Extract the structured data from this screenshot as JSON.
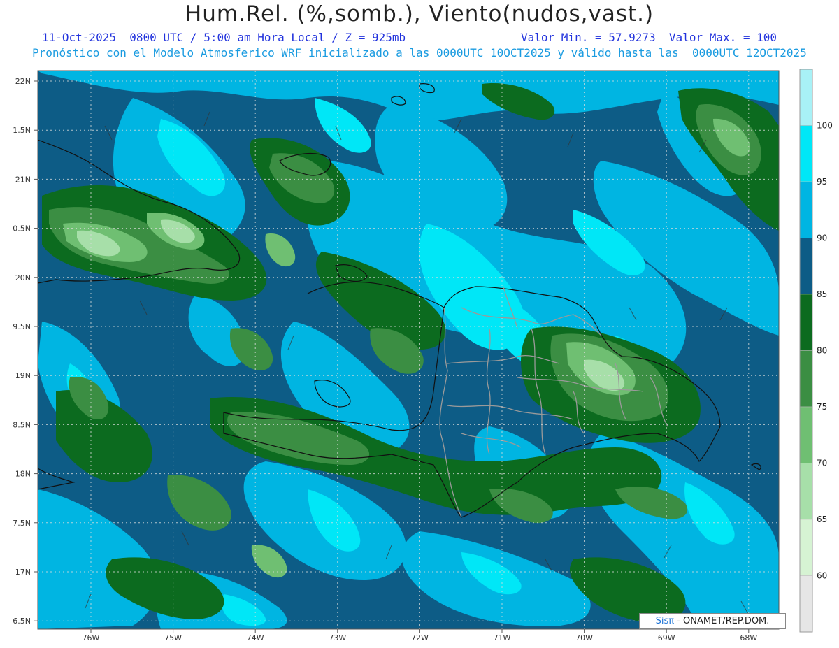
{
  "header": {
    "title": "Hum.Rel. (%,somb.), Viento(nudos,vast.)",
    "valid_time": "11-Oct-2025  0800 UTC / 5:00 am Hora Local / Z = 925mb",
    "min_max": "Valor Min. = 57.9273  Valor Max. = 100",
    "model_info": "Pronóstico con el Modelo Atmosferico WRF inicializado a las 0000UTC_10OCT2025 y válido hasta las  0000UTC_12OCT2025"
  },
  "map": {
    "lat_labels": [
      "22N",
      "1.5N",
      "21N",
      "0.5N",
      "20N",
      "9.5N",
      "19N",
      "8.5N",
      "18N",
      "7.5N",
      "17N",
      "6.5N"
    ],
    "lon_labels": [
      "76W",
      "75W",
      "74W",
      "73W",
      "72W",
      "71W",
      "70W",
      "69W",
      "68W"
    ],
    "background_color": "#0d5c86",
    "level_colors": {
      "below_70": "#a7dfa9",
      "70_75": "#6fbf72",
      "75_80": "#3b8e43",
      "80_85": "#0c6b1f",
      "85_90": "#0d5c86",
      "90_95": "#00b5e2",
      "95_100": "#00e7f7"
    }
  },
  "colorbar": {
    "labels": [
      "100",
      "95",
      "90",
      "85",
      "80",
      "75",
      "70",
      "65",
      "60"
    ],
    "colors": [
      "#a8f1f6",
      "#00e7f7",
      "#00b5e2",
      "#0d5c86",
      "#0c6b1f",
      "#3b8e43",
      "#6fbf72",
      "#a7dfa9",
      "#d6f3d3",
      "#e6e6e6"
    ]
  },
  "credit": {
    "logo": "Sisπ",
    "text": " - ONAMET/REP.DOM."
  }
}
